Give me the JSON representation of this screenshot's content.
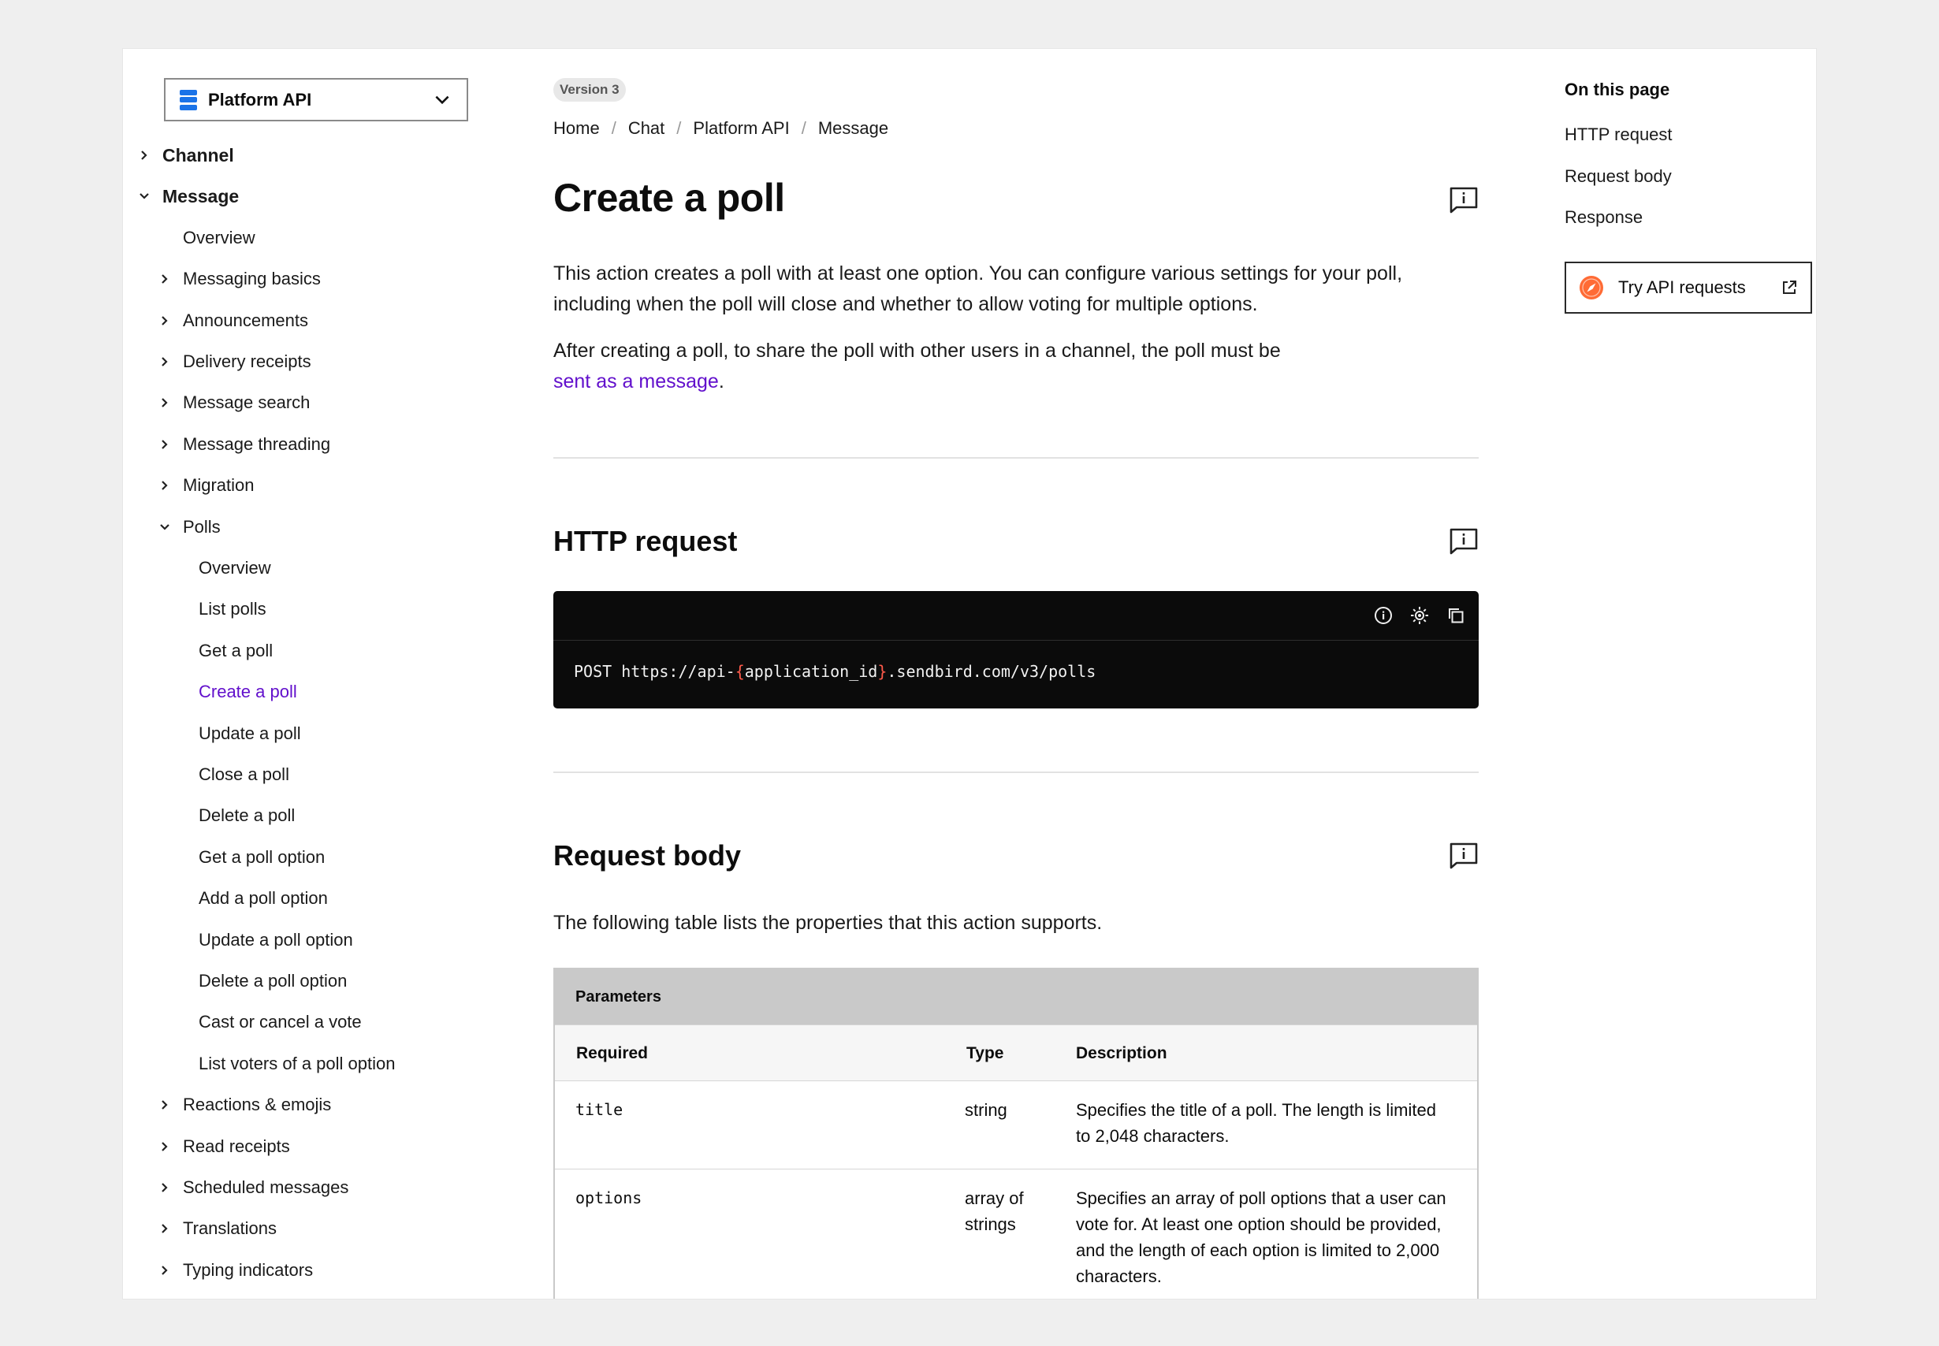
{
  "sidebar": {
    "product": "Platform API",
    "items": [
      {
        "label": "Channel",
        "level": 0,
        "caret": "right",
        "bold": true
      },
      {
        "label": "Message",
        "level": 0,
        "caret": "down",
        "bold": true
      },
      {
        "label": "Overview",
        "level": 1,
        "caret": "none"
      },
      {
        "label": "Messaging basics",
        "level": 1,
        "caret": "right"
      },
      {
        "label": "Announcements",
        "level": 1,
        "caret": "right"
      },
      {
        "label": "Delivery receipts",
        "level": 1,
        "caret": "right"
      },
      {
        "label": "Message search",
        "level": 1,
        "caret": "right"
      },
      {
        "label": "Message threading",
        "level": 1,
        "caret": "right"
      },
      {
        "label": "Migration",
        "level": 1,
        "caret": "right"
      },
      {
        "label": "Polls",
        "level": 1,
        "caret": "down"
      },
      {
        "label": "Overview",
        "level": 2,
        "caret": "none"
      },
      {
        "label": "List polls",
        "level": 2,
        "caret": "none"
      },
      {
        "label": "Get a poll",
        "level": 2,
        "caret": "none"
      },
      {
        "label": "Create a poll",
        "level": 2,
        "caret": "none",
        "active": true
      },
      {
        "label": "Update a poll",
        "level": 2,
        "caret": "none"
      },
      {
        "label": "Close a poll",
        "level": 2,
        "caret": "none"
      },
      {
        "label": "Delete a poll",
        "level": 2,
        "caret": "none"
      },
      {
        "label": "Get a poll option",
        "level": 2,
        "caret": "none"
      },
      {
        "label": "Add a poll option",
        "level": 2,
        "caret": "none"
      },
      {
        "label": "Update a poll option",
        "level": 2,
        "caret": "none"
      },
      {
        "label": "Delete a poll option",
        "level": 2,
        "caret": "none"
      },
      {
        "label": "Cast or cancel a vote",
        "level": 2,
        "caret": "none"
      },
      {
        "label": "List voters of a poll option",
        "level": 2,
        "caret": "none"
      },
      {
        "label": "Reactions & emojis",
        "level": 1,
        "caret": "right"
      },
      {
        "label": "Read receipts",
        "level": 1,
        "caret": "right"
      },
      {
        "label": "Scheduled messages",
        "level": 1,
        "caret": "right"
      },
      {
        "label": "Translations",
        "level": 1,
        "caret": "right"
      },
      {
        "label": "Typing indicators",
        "level": 1,
        "caret": "right"
      }
    ]
  },
  "main": {
    "version": "Version 3",
    "breadcrumb": [
      "Home",
      "Chat",
      "Platform API",
      "Message"
    ],
    "title": "Create a poll",
    "intro1": "This action creates a poll with at least one option. You can configure various settings for your poll, including when the poll will close and whether to allow voting for multiple options.",
    "intro2_before": "After creating a poll, to share the poll with other users in a channel, the poll must be",
    "intro2_link": "sent as a message",
    "intro2_after": ".",
    "http_heading": "HTTP request",
    "code": {
      "method": "POST",
      "url_prefix": "https://api-",
      "open_brace": "{",
      "param": "application_id",
      "close_brace": "}",
      "url_suffix": ".sendbird.com/v3/polls"
    },
    "body_heading": "Request body",
    "body_intro": "The following table lists the properties that this action supports.",
    "table": {
      "caption": "Parameters",
      "headers": {
        "name": "Required",
        "type": "Type",
        "desc": "Description"
      },
      "rows": [
        {
          "name": "title",
          "type": "string",
          "desc": "Specifies the title of a poll. The length is limited to 2,048 characters."
        },
        {
          "name": "options",
          "type": "array of strings",
          "desc": "Specifies an array of poll options that a user can vote for. At least one option should be provided, and the length of each option is limited to 2,000 characters."
        }
      ]
    }
  },
  "rail": {
    "title": "On this page",
    "toc": [
      "HTTP request",
      "Request body",
      "Response"
    ],
    "try_button": "Try API requests"
  },
  "colors": {
    "accent": "#6210cc",
    "brand_blue": "#1a73e8",
    "code_bg": "#0b0b0b",
    "brace": "#ff5a4a",
    "compass": "#ff6b35"
  }
}
